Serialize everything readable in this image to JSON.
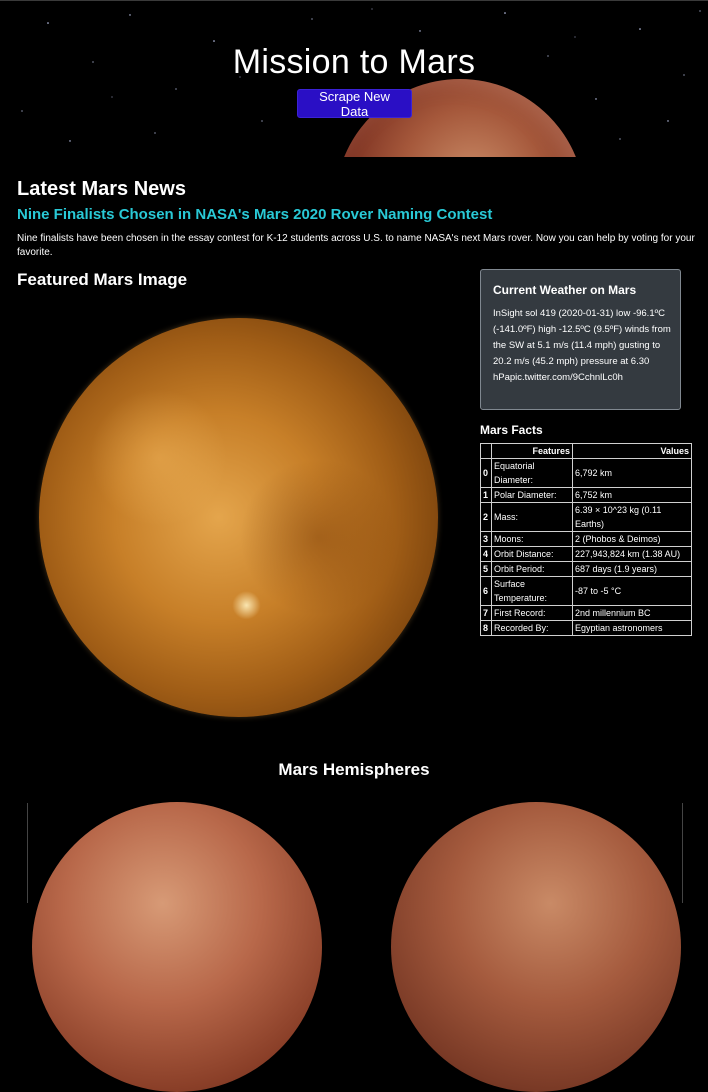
{
  "header": {
    "title": "Mission to Mars",
    "scrape_button": "Scrape New Data"
  },
  "news": {
    "heading": "Latest Mars News",
    "title": "Nine Finalists Chosen in NASA's Mars 2020 Rover Naming Contest",
    "paragraph": "Nine finalists have been chosen in the essay contest for K-12 students across U.S. to name NASA's next Mars rover. Now you can help by voting for your favorite."
  },
  "featured": {
    "heading": "Featured Mars Image"
  },
  "weather": {
    "title": "Current Weather on Mars",
    "text": "InSight sol 419 (2020-01-31) low -96.1ºC (-141.0ºF) high -12.5ºC (9.5ºF) winds from the SW at 5.1 m/s (11.4 mph) gusting to 20.2 m/s (45.2 mph) pressure at 6.30 hPapic.twitter.com/9CchnlLc0h"
  },
  "facts": {
    "heading": "Mars Facts",
    "columns": [
      "Features",
      "Values"
    ],
    "rows": [
      {
        "idx": "0",
        "feature": "Equatorial Diameter:",
        "value": "6,792 km"
      },
      {
        "idx": "1",
        "feature": "Polar Diameter:",
        "value": "6,752 km"
      },
      {
        "idx": "2",
        "feature": "Mass:",
        "value": "6.39 × 10^23 kg (0.11 Earths)"
      },
      {
        "idx": "3",
        "feature": "Moons:",
        "value": "2 (Phobos & Deimos)"
      },
      {
        "idx": "4",
        "feature": "Orbit Distance:",
        "value": "227,943,824 km (1.38 AU)"
      },
      {
        "idx": "5",
        "feature": "Orbit Period:",
        "value": "687 days (1.9 years)"
      },
      {
        "idx": "6",
        "feature": "Surface Temperature:",
        "value": "-87 to -5 °C"
      },
      {
        "idx": "7",
        "feature": "First Record:",
        "value": "2nd millennium BC"
      },
      {
        "idx": "8",
        "feature": "Recorded By:",
        "value": "Egyptian astronomers"
      }
    ]
  },
  "hemispheres": {
    "heading": "Mars Hemispheres"
  },
  "colors": {
    "background": "#000000",
    "button": "#2a0fc5",
    "news_title": "#29c9d6",
    "card": "#343a40"
  }
}
